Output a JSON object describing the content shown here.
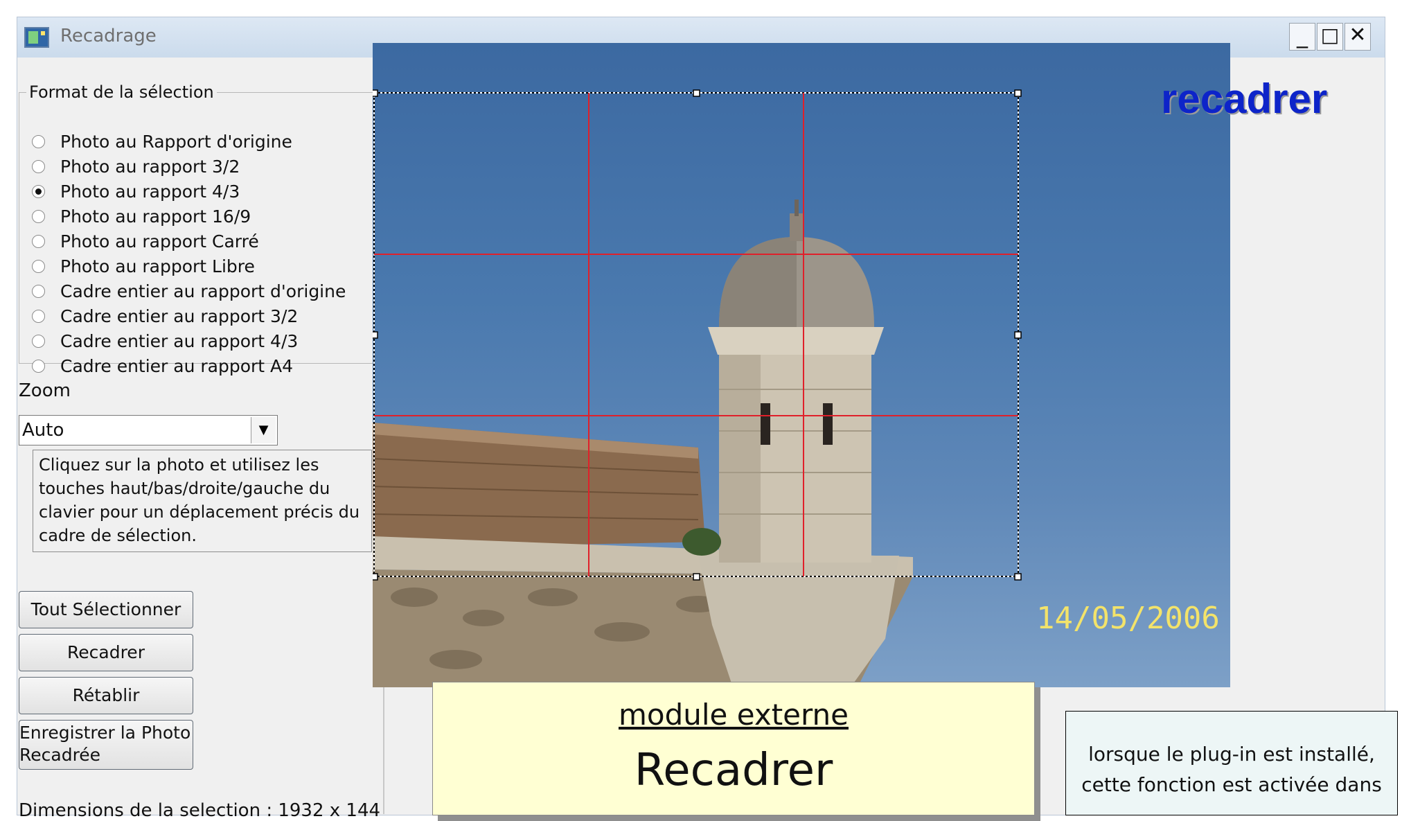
{
  "window": {
    "title": "Recadrage",
    "controls": {
      "minimize": "_",
      "maximize": "□",
      "close": "✕"
    }
  },
  "format_group": {
    "legend": "Format de la sélection",
    "options": [
      {
        "label": "Photo au Rapport d'origine",
        "checked": false
      },
      {
        "label": "Photo au rapport 3/2",
        "checked": false
      },
      {
        "label": "Photo au rapport 4/3",
        "checked": true
      },
      {
        "label": "Photo au rapport 16/9",
        "checked": false
      },
      {
        "label": "Photo au rapport Carré",
        "checked": false
      },
      {
        "label": "Photo au rapport Libre",
        "checked": false
      },
      {
        "label": "Cadre entier au rapport d'origine",
        "checked": false
      },
      {
        "label": "Cadre entier au rapport 3/2",
        "checked": false
      },
      {
        "label": "Cadre entier au rapport 4/3",
        "checked": false
      },
      {
        "label": "Cadre entier au rapport A4",
        "checked": false
      }
    ]
  },
  "zoom": {
    "label": "Zoom",
    "value": "Auto",
    "arrow": "▼"
  },
  "help_text": "Cliquez sur la photo et utilisez les touches haut/bas/droite/gauche du clavier pour un déplacement précis du cadre de sélection.",
  "buttons": {
    "select_all": "Tout Sélectionner",
    "crop": "Recadrer",
    "restore": "Rétablir",
    "save_line1": "Enregistrer la Photo",
    "save_line2": "Recadrée"
  },
  "status": "Dimensions de la selection :  1932 x  144",
  "photo": {
    "date_stamp": "14/05/2006"
  },
  "overlay": {
    "heading": "recadrer",
    "module_title": "module externe",
    "module_name": "Recadrer",
    "note": "lorsque le plug-in est installé, cette fonction est activée dans"
  },
  "colors": {
    "heading": "#0d24c9",
    "grid_lines": "#e0202a",
    "date_stamp": "#f3e36a",
    "module_bg": "#ffffd3",
    "note_bg": "#edf6f6"
  }
}
